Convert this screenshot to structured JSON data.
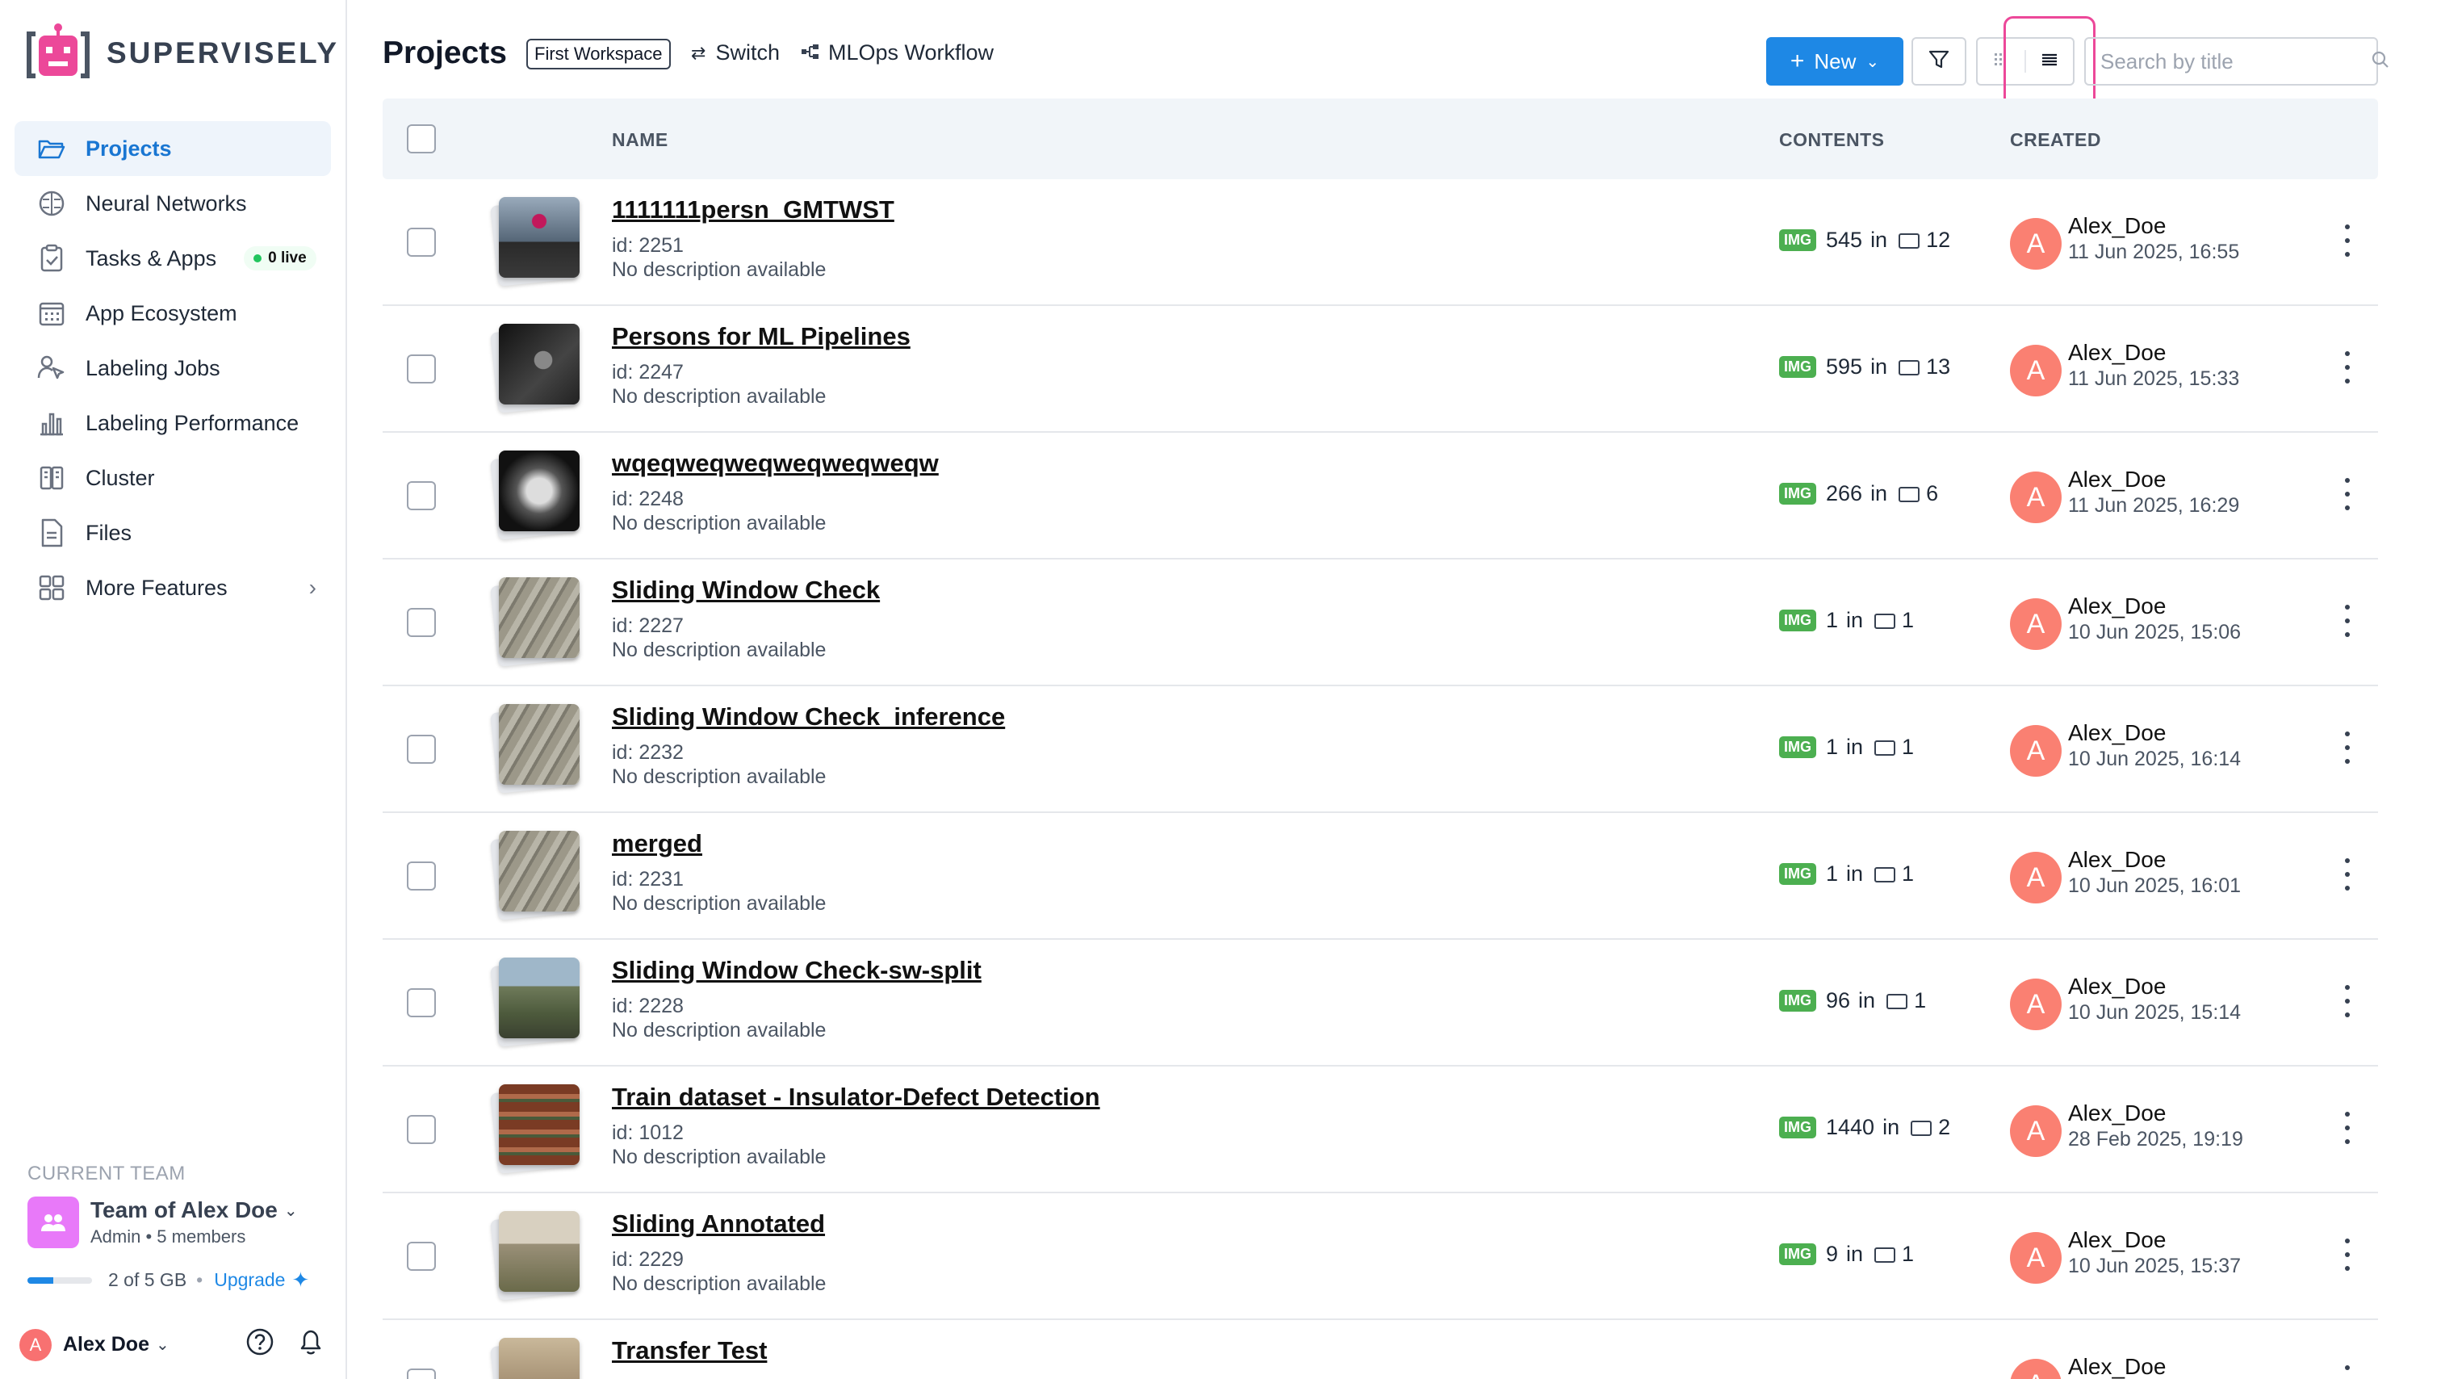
{
  "brand": {
    "name": "SUPERVISELY"
  },
  "sidebar": {
    "items": [
      {
        "label": "Projects",
        "icon": "folder-open-icon",
        "active": true
      },
      {
        "label": "Neural Networks",
        "icon": "brain-icon"
      },
      {
        "label": "Tasks & Apps",
        "icon": "clipboard-check-icon",
        "badge": "0 live"
      },
      {
        "label": "App Ecosystem",
        "icon": "app-grid-icon"
      },
      {
        "label": "Labeling Jobs",
        "icon": "people-cursor-icon"
      },
      {
        "label": "Labeling Performance",
        "icon": "bar-chart-icon"
      },
      {
        "label": "Cluster",
        "icon": "server-icon"
      },
      {
        "label": "Files",
        "icon": "file-icon"
      },
      {
        "label": "More Features",
        "icon": "grid-icon"
      }
    ],
    "team": {
      "caption": "CURRENT TEAM",
      "name": "Team of Alex Doe",
      "role": "Admin",
      "members": "5 members",
      "storage": "2 of 5 GB",
      "storage_fraction": 0.4,
      "upgrade": "Upgrade"
    },
    "user": {
      "initial": "A",
      "name": "Alex Doe"
    }
  },
  "header": {
    "title": "Projects",
    "workspace": "First Workspace",
    "switch_label": "Switch",
    "mlops_label": "MLOps Workflow",
    "new_button": "New",
    "search_placeholder": "Search by title"
  },
  "table": {
    "columns": {
      "name": "NAME",
      "contents": "CONTENTS",
      "created": "CREATED"
    },
    "rows": [
      {
        "title": "1111111persn_GMTWST",
        "id": "id: 2251",
        "desc": "No description available",
        "badge": "IMG",
        "count": "545",
        "in": "in",
        "folders": "12",
        "user_initial": "A",
        "user": "Alex_Doe",
        "date": "11 Jun 2025, 16:55",
        "thumb": "person-red"
      },
      {
        "title": "Persons for ML Pipelines",
        "id": "id: 2247",
        "desc": "No description available",
        "badge": "IMG",
        "count": "595",
        "in": "in",
        "folders": "13",
        "user_initial": "A",
        "user": "Alex_Doe",
        "date": "11 Jun 2025, 15:33",
        "thumb": "person-bw"
      },
      {
        "title": "wqeqweqweqweqweqweqw",
        "id": "id: 2248",
        "desc": "No description available",
        "badge": "IMG",
        "count": "266",
        "in": "in",
        "folders": "6",
        "user_initial": "A",
        "user": "Alex_Doe",
        "date": "11 Jun 2025, 16:29",
        "thumb": "tunnel-bw"
      },
      {
        "title": "Sliding Window Check",
        "id": "id: 2227",
        "desc": "No description available",
        "badge": "IMG",
        "count": "1",
        "in": "in",
        "folders": "1",
        "user_initial": "A",
        "user": "Alex_Doe",
        "date": "10 Jun 2025, 15:06",
        "thumb": "highway"
      },
      {
        "title": "Sliding Window Check_inference",
        "id": "id: 2232",
        "desc": "No description available",
        "badge": "IMG",
        "count": "1",
        "in": "in",
        "folders": "1",
        "user_initial": "A",
        "user": "Alex_Doe",
        "date": "10 Jun 2025, 16:14",
        "thumb": "highway"
      },
      {
        "title": "merged",
        "id": "id: 2231",
        "desc": "No description available",
        "badge": "IMG",
        "count": "1",
        "in": "in",
        "folders": "1",
        "user_initial": "A",
        "user": "Alex_Doe",
        "date": "10 Jun 2025, 16:01",
        "thumb": "highway"
      },
      {
        "title": "Sliding Window Check-sw-split",
        "id": "id: 2228",
        "desc": "No description available",
        "badge": "IMG",
        "count": "96",
        "in": "in",
        "folders": "1",
        "user_initial": "A",
        "user": "Alex_Doe",
        "date": "10 Jun 2025, 15:14",
        "thumb": "city"
      },
      {
        "title": "Train dataset - Insulator-Defect Detection",
        "id": "id: 1012",
        "desc": "No description available",
        "badge": "IMG",
        "count": "1440",
        "in": "in",
        "folders": "2",
        "user_initial": "A",
        "user": "Alex_Doe",
        "date": "28 Feb 2025, 19:19",
        "thumb": "insulator"
      },
      {
        "title": "Sliding Annotated",
        "id": "id: 2229",
        "desc": "No description available",
        "badge": "IMG",
        "count": "9",
        "in": "in",
        "folders": "1",
        "user_initial": "A",
        "user": "Alex_Doe",
        "date": "10 Jun 2025, 15:37",
        "thumb": "road"
      },
      {
        "title": "Transfer Test",
        "id": "",
        "desc": "",
        "badge": "",
        "count": "",
        "in": "",
        "folders": "",
        "user_initial": "A",
        "user": "Alex_Doe",
        "date": "",
        "thumb": "room"
      }
    ]
  },
  "colors": {
    "accent": "#1e88e5",
    "active_bg": "#eef4fb",
    "img_badge": "#4caf50",
    "avatar": "#fa8072",
    "highlight": "#ec4899"
  }
}
